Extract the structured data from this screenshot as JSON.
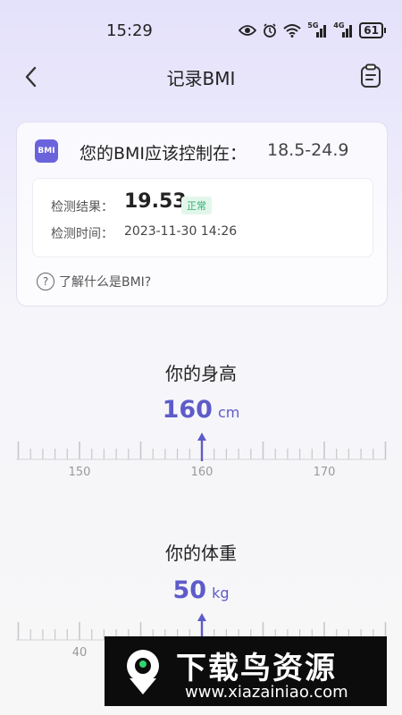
{
  "status_bar": {
    "time": "15:29",
    "signal1_label": "5G",
    "signal2_label": "4G",
    "battery": "61"
  },
  "nav": {
    "title": "记录BMI"
  },
  "bmi_card": {
    "badge": "BMI",
    "range_label": "您的BMI应该控制在：",
    "range_value": "18.5-24.9",
    "result_label": "检测结果：",
    "result_value": "19.53",
    "result_status": "正常",
    "time_label": "检测时间：",
    "time_value": "2023-11-30 14:26",
    "help_text": "了解什么是BMI?"
  },
  "height": {
    "title": "你的身高",
    "value": "160",
    "unit": "cm",
    "ruler_labels": [
      "150",
      "160",
      "170"
    ]
  },
  "weight": {
    "title": "你的体重",
    "value": "50",
    "unit": "kg",
    "ruler_labels": [
      "40"
    ]
  },
  "watermark": {
    "title": "下载鸟资源",
    "url": "www.xiazainiao.com"
  },
  "colors": {
    "accent": "#5e5bc9",
    "badge": "#6b63dc",
    "status_green": "#2eb36b"
  }
}
